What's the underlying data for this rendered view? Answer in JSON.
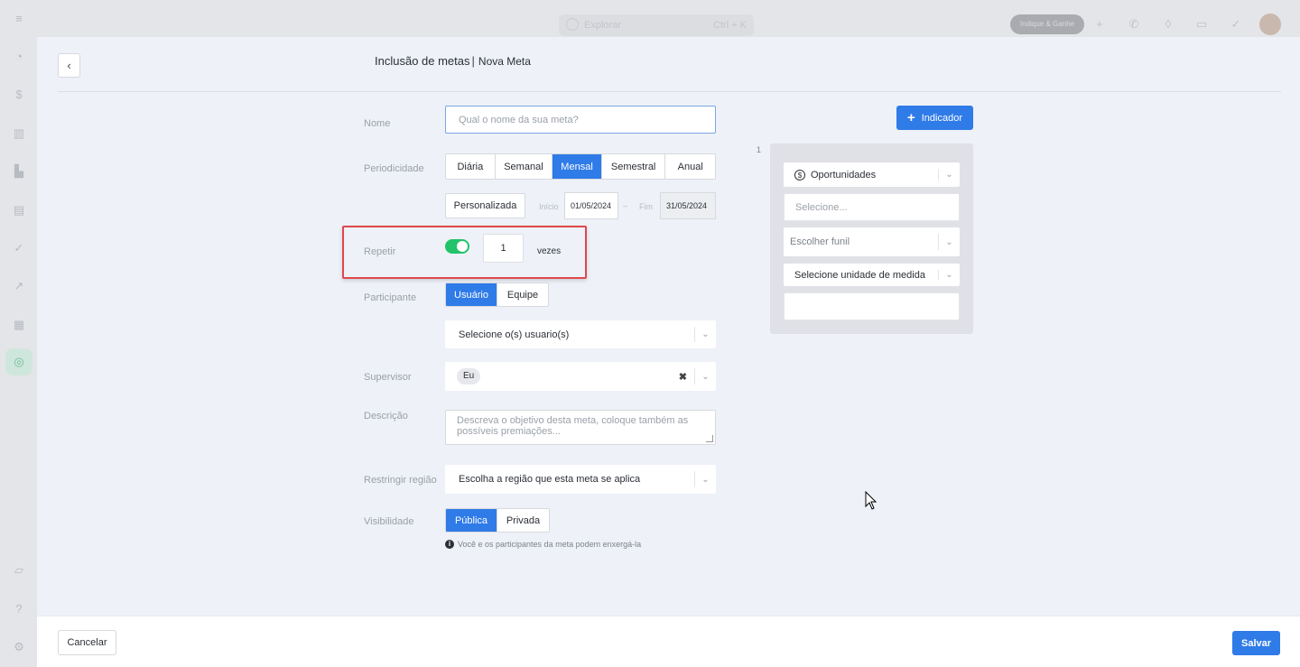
{
  "background": {
    "search": {
      "placeholder": "Explorar",
      "shortcut": "Ctrl + K"
    },
    "indique_label": "Indique & Ganhe"
  },
  "header": {
    "title": "Inclusão de metas",
    "separator": "|",
    "subtitle": "Nova Meta"
  },
  "form": {
    "name": {
      "label": "Nome",
      "placeholder": "Qual o nome da sua meta?"
    },
    "periodicity": {
      "label": "Periodicidade",
      "options": [
        "Diária",
        "Semanal",
        "Mensal",
        "Semestral",
        "Anual"
      ],
      "selected": "Mensal",
      "custom_label": "Personalizada",
      "start_label": "Início",
      "start_value": "01/05/2024",
      "range_separator": "–",
      "end_label": "Fim",
      "end_value": "31/05/2024"
    },
    "repeat": {
      "label": "Repetir",
      "enabled": true,
      "value": "1",
      "suffix": "vezes"
    },
    "participant": {
      "label": "Participante",
      "options": [
        "Usuário",
        "Equipe"
      ],
      "selected": "Usuário",
      "users_placeholder": "Selecione o(s) usuario(s)"
    },
    "supervisor": {
      "label": "Supervisor",
      "value": "Eu"
    },
    "description": {
      "label": "Descrição",
      "placeholder": "Descreva o objetivo desta meta, coloque também as possíveis premiações..."
    },
    "region": {
      "label": "Restringir região",
      "placeholder": "Escolha a região que esta meta se aplica"
    },
    "visibility": {
      "label": "Visibilidade",
      "options": [
        "Pública",
        "Privada"
      ],
      "selected": "Pública",
      "info": "Você e os participantes da meta podem enxergá-la"
    }
  },
  "indicator": {
    "add_button": "Indicador",
    "index": "1",
    "type": "Oportunidades",
    "select_placeholder": "Selecione...",
    "funnel_placeholder": "Escolher funil",
    "unit_placeholder": "Selecione unidade de medida"
  },
  "footer": {
    "cancel": "Cancelar",
    "save": "Salvar"
  },
  "colors": {
    "primary": "#2f7be8",
    "toggle_on": "#22c36a",
    "highlight": "#e0474c"
  }
}
